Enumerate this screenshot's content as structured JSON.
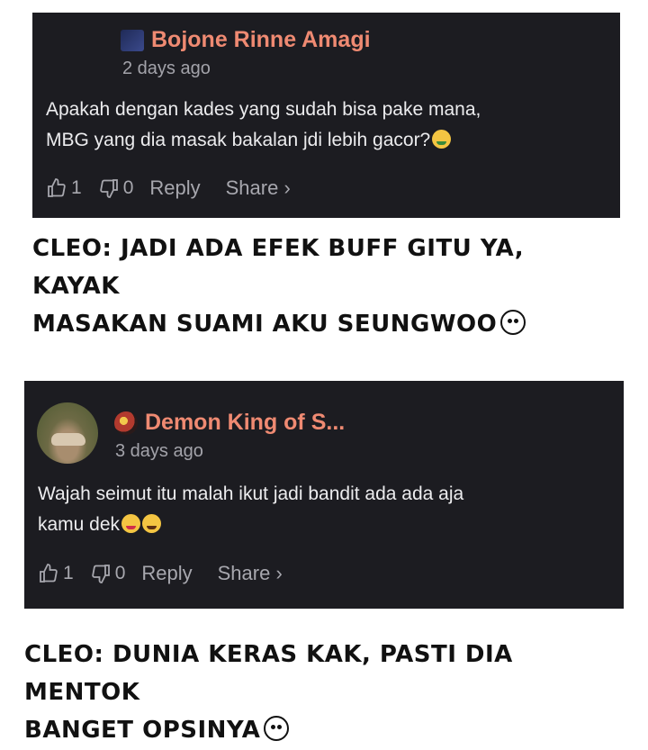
{
  "comments": [
    {
      "username": "Bojone Rinne Amagi",
      "timestamp": "2 days ago",
      "body_line1": "Apakah dengan kades yang sudah bisa pake mana,",
      "body_line2": "MBG yang dia masak bakalan jdi lebih gacor?",
      "likes": "1",
      "dislikes": "0",
      "reply_label": "Reply",
      "share_label": "Share ›"
    },
    {
      "username": "Demon King of S...",
      "timestamp": "3 days ago",
      "body_line1": "Wajah seimut itu malah ikut jadi bandit ada ada aja",
      "body_line2": "kamu dek",
      "likes": "1",
      "dislikes": "0",
      "reply_label": "Reply",
      "share_label": "Share ›"
    }
  ],
  "captions": [
    {
      "line1": "CLEO: JADI ADA EFEK BUFF GITU YA, KAYAK",
      "line2": "MASAKAN SUAMI AKU SEUNGWOO"
    },
    {
      "line1": "CLEO: DUNIA KERAS KAK, PASTI DIA MENTOK",
      "line2": "BANGET OPSINYA"
    }
  ],
  "colors": {
    "card_bg": "#1c1c21",
    "username": "#ef8a72",
    "muted": "#a3a3aa"
  }
}
